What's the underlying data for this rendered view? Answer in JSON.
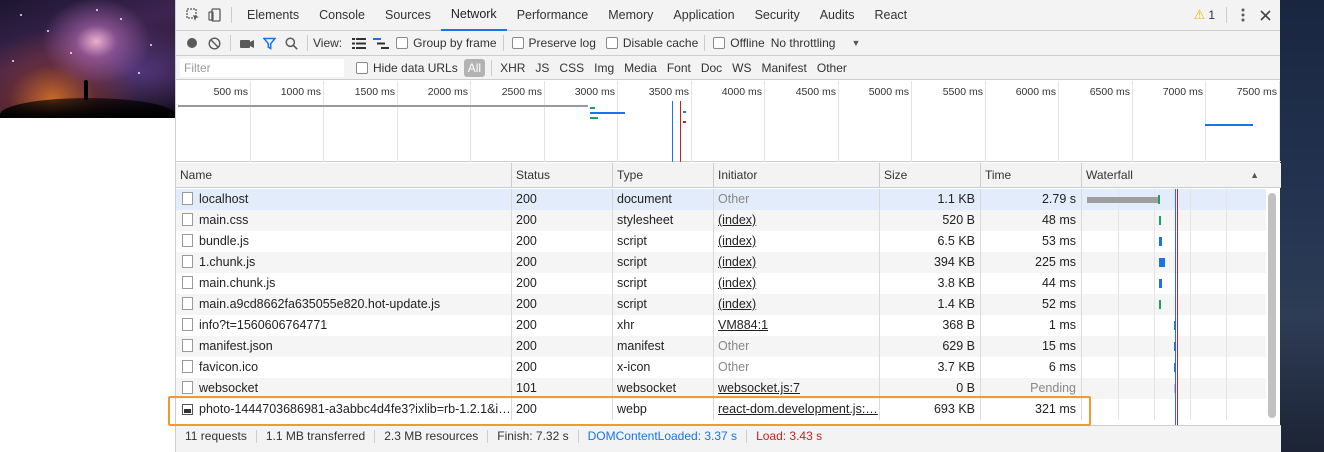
{
  "devtools": {
    "tabs": [
      "Elements",
      "Console",
      "Sources",
      "Network",
      "Performance",
      "Memory",
      "Application",
      "Security",
      "Audits",
      "React"
    ],
    "active_tab": "Network",
    "warning_count": "1"
  },
  "toolbar": {
    "view_label": "View:",
    "group_by_frame": "Group by frame",
    "preserve_log": "Preserve log",
    "disable_cache": "Disable cache",
    "offline": "Offline",
    "throttling": "No throttling"
  },
  "filterbar": {
    "placeholder": "Filter",
    "hide_data_urls": "Hide data URLs",
    "types": [
      "All",
      "XHR",
      "JS",
      "CSS",
      "Img",
      "Media",
      "Font",
      "Doc",
      "WS",
      "Manifest",
      "Other"
    ],
    "selected_type": "All"
  },
  "overview": {
    "ticks": [
      "500 ms",
      "1000 ms",
      "1500 ms",
      "2000 ms",
      "2500 ms",
      "3000 ms",
      "3500 ms",
      "4000 ms",
      "4500 ms",
      "5000 ms",
      "5500 ms",
      "6000 ms",
      "6500 ms",
      "7000 ms",
      "7500 ms"
    ]
  },
  "table": {
    "headers": {
      "name": "Name",
      "status": "Status",
      "type": "Type",
      "initiator": "Initiator",
      "size": "Size",
      "time": "Time",
      "waterfall": "Waterfall"
    },
    "rows": [
      {
        "name": "localhost",
        "status": "200",
        "type": "document",
        "initiator": "Other",
        "size": "1.1 KB",
        "time": "2.79 s"
      },
      {
        "name": "main.css",
        "status": "200",
        "type": "stylesheet",
        "initiator": "(index)",
        "size": "520 B",
        "time": "48 ms"
      },
      {
        "name": "bundle.js",
        "status": "200",
        "type": "script",
        "initiator": "(index)",
        "size": "6.5 KB",
        "time": "53 ms"
      },
      {
        "name": "1.chunk.js",
        "status": "200",
        "type": "script",
        "initiator": "(index)",
        "size": "394 KB",
        "time": "225 ms"
      },
      {
        "name": "main.chunk.js",
        "status": "200",
        "type": "script",
        "initiator": "(index)",
        "size": "3.8 KB",
        "time": "44 ms"
      },
      {
        "name": "main.a9cd8662fa635055e820.hot-update.js",
        "status": "200",
        "type": "script",
        "initiator": "(index)",
        "size": "1.4 KB",
        "time": "52 ms"
      },
      {
        "name": "info?t=1560606764771",
        "status": "200",
        "type": "xhr",
        "initiator": "VM884:1",
        "size": "368 B",
        "time": "1 ms"
      },
      {
        "name": "manifest.json",
        "status": "200",
        "type": "manifest",
        "initiator": "Other",
        "size": "629 B",
        "time": "15 ms"
      },
      {
        "name": "favicon.ico",
        "status": "200",
        "type": "x-icon",
        "initiator": "Other",
        "size": "3.7 KB",
        "time": "6 ms"
      },
      {
        "name": "websocket",
        "status": "101",
        "type": "websocket",
        "initiator": "websocket.js:7",
        "size": "0 B",
        "time": "Pending"
      },
      {
        "name": "photo-1444703686981-a3abbc4d4fe3?ixlib=rb-1.2.1&i…",
        "status": "200",
        "type": "webp",
        "initiator": "react-dom.development.js:…",
        "size": "693 KB",
        "time": "321 ms"
      }
    ]
  },
  "statusbar": {
    "requests": "11 requests",
    "transferred": "1.1 MB transferred",
    "resources": "2.3 MB resources",
    "finish": "Finish: 7.32 s",
    "dom_content_loaded": "DOMContentLoaded: 3.37 s",
    "load": "Load: 3.43 s"
  },
  "colors": {
    "accent": "#1a73e8",
    "load_red": "#c5221f",
    "highlight_orange": "#f29a2e",
    "waterfall_teal": "#1aa260"
  }
}
